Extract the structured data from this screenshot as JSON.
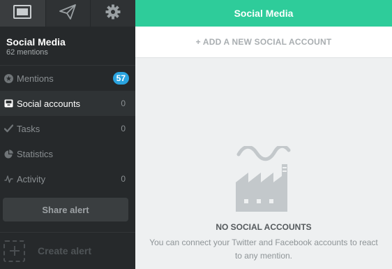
{
  "sidebar": {
    "toolbar": [
      {
        "icon": "screen-icon",
        "active": true
      },
      {
        "icon": "paper-plane-icon",
        "active": false
      },
      {
        "icon": "gear-icon",
        "active": false
      }
    ],
    "project": {
      "name": "Social Media",
      "mentions": "62 mentions"
    },
    "nav": [
      {
        "label": "Mentions",
        "count": "57",
        "icon": "star-circle-icon",
        "badge": true
      },
      {
        "label": "Social accounts",
        "count": "0",
        "icon": "inbox-icon",
        "active": true
      },
      {
        "label": "Tasks",
        "count": "0",
        "icon": "checkmark-icon"
      },
      {
        "label": "Statistics",
        "count": "",
        "icon": "pie-chart-icon"
      },
      {
        "label": "Activity",
        "count": "0",
        "icon": "pulse-icon"
      }
    ],
    "share_label": "Share alert",
    "create_label": "Create alert"
  },
  "header": {
    "title": "Social Media"
  },
  "main": {
    "add_account_label": "+ ADD A NEW SOCIAL ACCOUNT",
    "empty": {
      "headline": "NO SOCIAL ACCOUNTS",
      "description": "You can connect your Twitter and Facebook accounts to react to any mention.",
      "icon": "factory-icon"
    }
  },
  "colors": {
    "accent": "#2ecc9a",
    "badge": "#2aa4e0",
    "sidebar": "#26292b"
  }
}
